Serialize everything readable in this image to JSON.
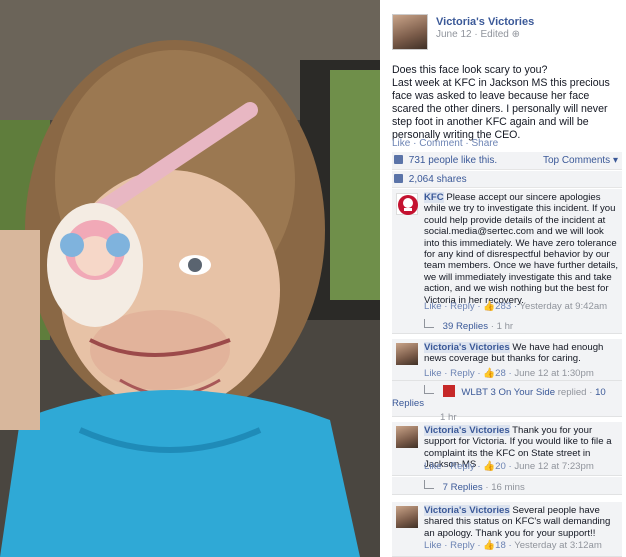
{
  "post": {
    "page_name": "Victoria's Victories",
    "date": "June 12",
    "edited_label": "Edited",
    "text_line1": "Does this face look scary to you?",
    "text_line2": "Last week at KFC in Jackson MS this precious face was asked to leave because her face scared the other diners. I personally will never step foot in another KFC again and will be personally writing the CEO.",
    "actions": {
      "like": "Like",
      "comment": "Comment",
      "share": "Share"
    },
    "likes_text": "731 people like this.",
    "top_comments": "Top Comments",
    "shares_text": "2,064 shares"
  },
  "comments": [
    {
      "author": "KFC",
      "text": "Please accept our sincere apologies while we try to investigate this incident. If you could help provide details of the incident at social.media@sertec.com and we will look into this immediately. We have zero tolerance for any kind of disrespectful behavior by our team members. Once we have further details, we will immediately investigate this and take action, and we wish nothing but the best for Victoria in her recovery.",
      "like": "Like",
      "reply": "Reply",
      "count": "283",
      "time": "Yesterday at 9:42am",
      "replies_text": "39 Replies",
      "replies_time": "1 hr"
    },
    {
      "author": "Victoria's Victories",
      "text": "We have had enough news coverage but thanks for caring.",
      "like": "Like",
      "reply": "Reply",
      "count": "28",
      "time": "June 12 at 1:30pm",
      "sub_author": "WLBT 3 On Your Side",
      "sub_replied": "replied",
      "sub_count": "10 Replies",
      "sub_time": "1 hr"
    },
    {
      "author": "Victoria's Victories",
      "text": "Thank you for your support for Victoria. If you would like to file a complaint its the KFC on State street in Jackson MS",
      "like": "Like",
      "reply": "Reply",
      "count": "20",
      "time": "June 12 at 7:23pm",
      "replies_text": "7 Replies",
      "replies_time": "16 mins"
    },
    {
      "author": "Victoria's Victories",
      "text": "Several people have shared this status on KFC's wall demanding an apology. Thank you for your support!!",
      "like": "Like",
      "reply": "Reply",
      "count": "18",
      "time": "Yesterday at 3:12am"
    }
  ],
  "colors": {
    "link": "#3b5998",
    "muted": "#90949c",
    "panel_bg": "#f2f3f5"
  }
}
